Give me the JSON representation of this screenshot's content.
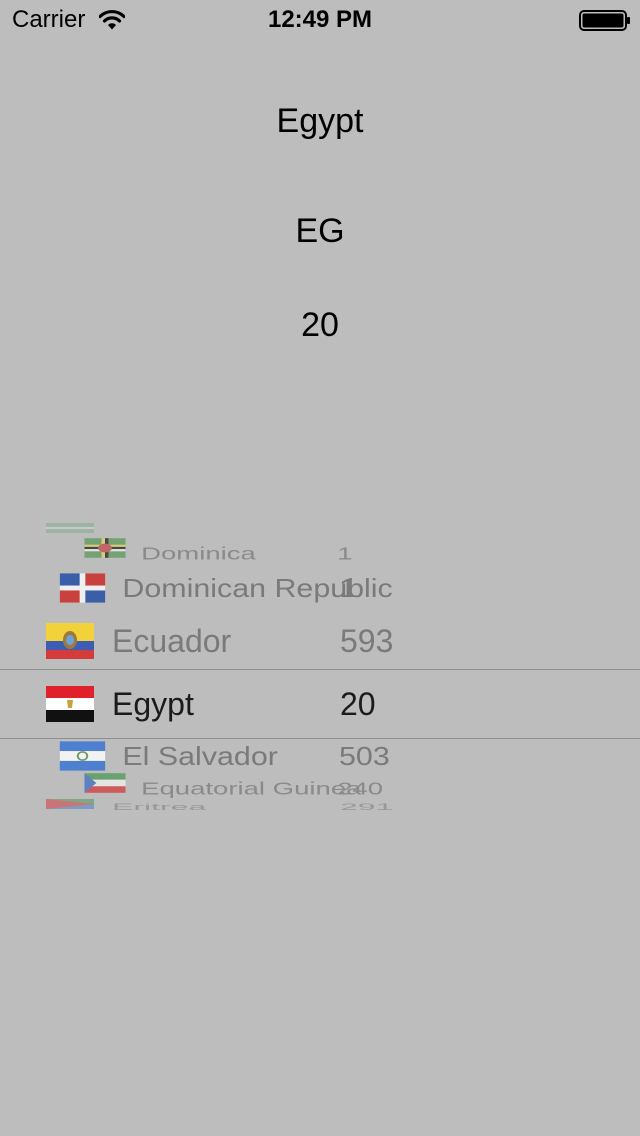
{
  "status_bar": {
    "carrier": "Carrier",
    "time": "12:49 PM",
    "wifi_icon": "wifi-icon",
    "battery_icon": "battery-icon"
  },
  "details": {
    "name": "Egypt",
    "code": "EG",
    "dial": "20"
  },
  "picker": {
    "selected_index": 3,
    "rows": [
      {
        "name": "Dominica",
        "dial": "1",
        "flag_icon": "dominica-flag-icon"
      },
      {
        "name": "Dominican Republic",
        "dial": "1",
        "flag_icon": "dominican-republic-flag-icon"
      },
      {
        "name": "Ecuador",
        "dial": "593",
        "flag_icon": "ecuador-flag-icon"
      },
      {
        "name": "Egypt",
        "dial": "20",
        "flag_icon": "egypt-flag-icon"
      },
      {
        "name": "El Salvador",
        "dial": "503",
        "flag_icon": "el-salvador-flag-icon"
      },
      {
        "name": "Equatorial Guinea",
        "dial": "240",
        "flag_icon": "equatorial-guinea-flag-icon"
      },
      {
        "name": "Eritrea",
        "dial": "291",
        "flag_icon": "eritrea-flag-icon"
      }
    ]
  },
  "colors": {
    "background": "#bdbdbd",
    "separator": "#8f8f8f",
    "selected_text": "#1b1b1b",
    "unselected_text": "#7a7a7a"
  }
}
